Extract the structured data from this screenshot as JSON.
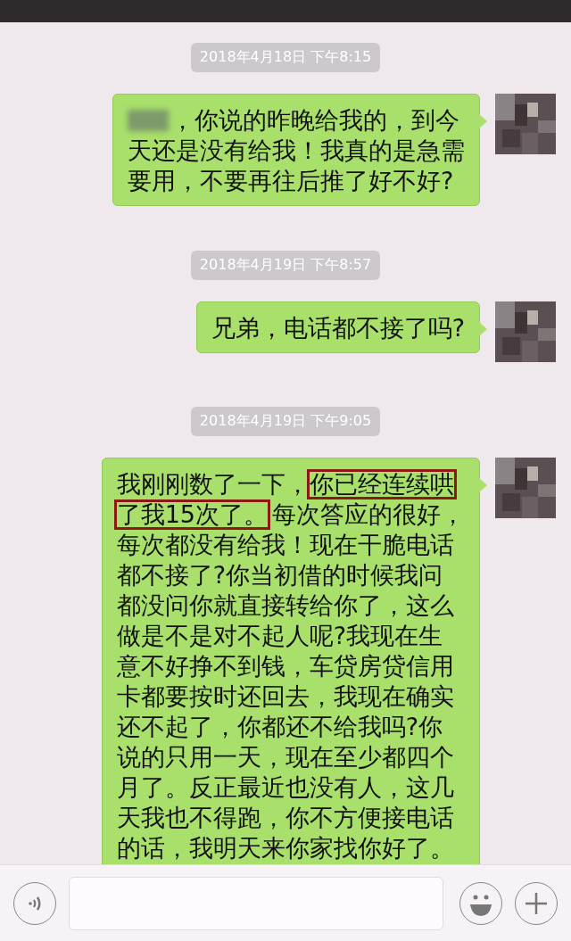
{
  "chat": [
    {
      "kind": "timestamp",
      "text": "2018年4月18日 下午8:15"
    },
    {
      "kind": "message",
      "redacted_name": true,
      "lines": [
        [
          {
            "text": "，你说的昨晚给我的，到今",
            "highlighted": false
          }
        ],
        [
          {
            "text": "天还是没有给我！我真的是急需",
            "highlighted": false
          }
        ],
        [
          {
            "text": "要用，不要再往后推了好不好?",
            "highlighted": false
          }
        ]
      ]
    },
    {
      "kind": "timestamp",
      "text": "2018年4月19日 下午8:57"
    },
    {
      "kind": "message",
      "redacted_name": false,
      "lines": [
        [
          {
            "text": "兄弟，电话都不接了吗?",
            "highlighted": false
          }
        ]
      ]
    },
    {
      "kind": "timestamp",
      "text": "2018年4月19日 下午9:05"
    },
    {
      "kind": "message",
      "redacted_name": false,
      "lines": [
        [
          {
            "text": "我刚刚数了一下，",
            "highlighted": false
          },
          {
            "text": "你已经连续哄",
            "highlighted": true
          }
        ],
        [
          {
            "text": "了我15次了。",
            "highlighted": true
          },
          {
            "text": "每次答应的很好，",
            "highlighted": false
          }
        ],
        [
          {
            "text": "每次都没有给我！现在干脆电话",
            "highlighted": false
          }
        ],
        [
          {
            "text": "都不接了?你当初借的时候我问",
            "highlighted": false
          }
        ],
        [
          {
            "text": "都没问你就直接转给你了，这么",
            "highlighted": false
          }
        ],
        [
          {
            "text": "做是不是对不起人呢?我现在生",
            "highlighted": false
          }
        ],
        [
          {
            "text": "意不好挣不到钱，车贷房贷信用",
            "highlighted": false
          }
        ],
        [
          {
            "text": "卡都要按时还回去，我现在确实",
            "highlighted": false
          }
        ],
        [
          {
            "text": "还不起了，你都还不给我吗?你",
            "highlighted": false
          }
        ],
        [
          {
            "text": "说的只用一天，现在至少都四个",
            "highlighted": false
          }
        ],
        [
          {
            "text": "月了。反正最近也没有人，这几",
            "highlighted": false
          }
        ],
        [
          {
            "text": "天我也不得跑，你不方便接电话",
            "highlighted": false
          }
        ],
        [
          {
            "text": "的话，我明天来你家找你好了。",
            "highlighted": false
          }
        ]
      ]
    }
  ]
}
